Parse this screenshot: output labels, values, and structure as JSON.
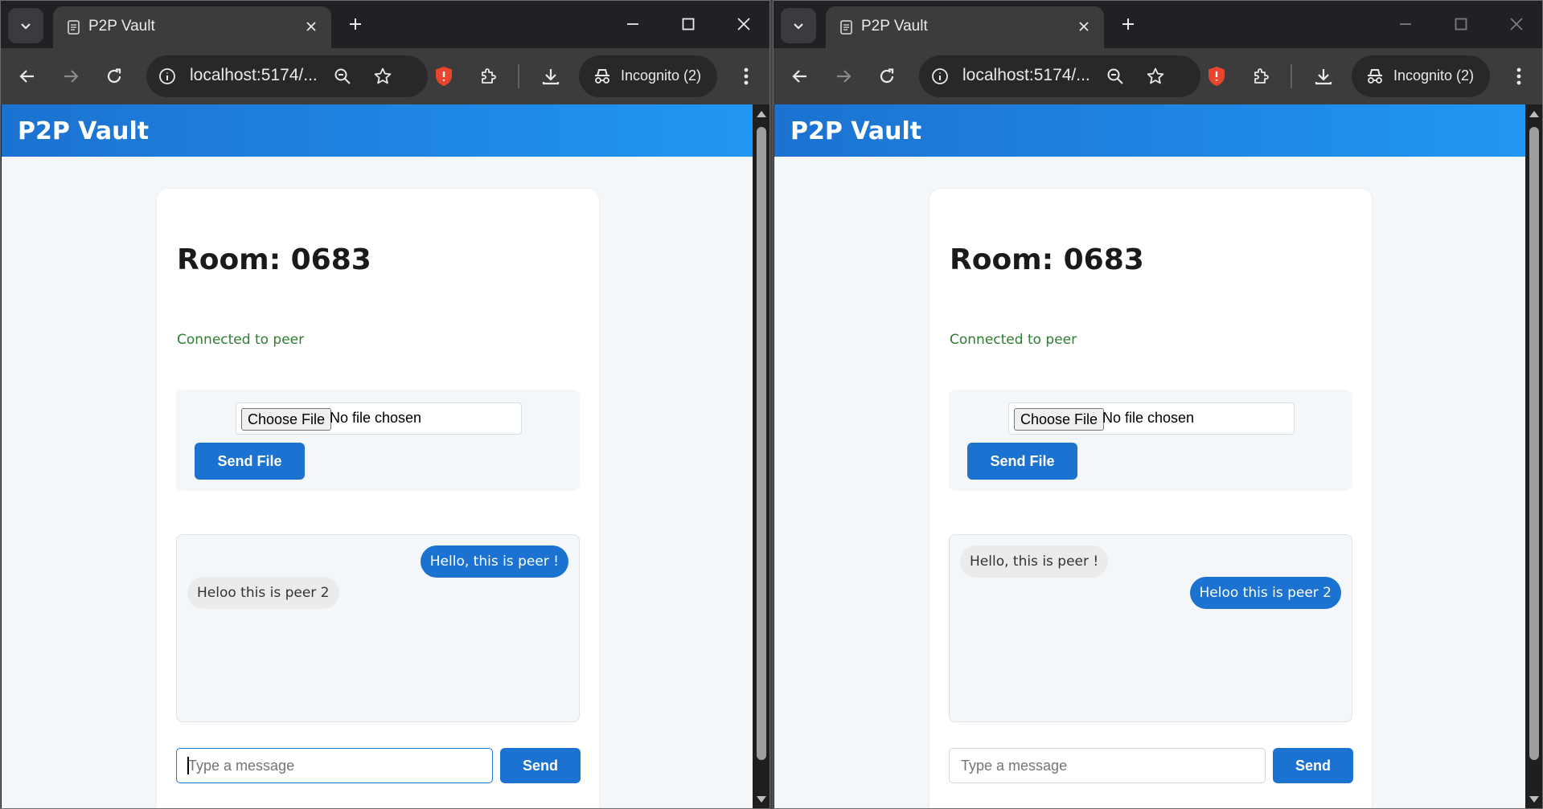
{
  "browser": {
    "tab_title": "P2P Vault",
    "url": "localhost:5174/...",
    "incognito_label": "Incognito (2)"
  },
  "app": {
    "brand": "P2P Vault",
    "room_label": "Room: 0683",
    "status": "Connected to peer",
    "choose_file_label": "Choose File",
    "no_file_label": "No file chosen",
    "send_file_label": "Send File",
    "message_placeholder": "Type a message",
    "send_label": "Send"
  },
  "windows": [
    {
      "messages": [
        {
          "text": "Hello, this is peer !",
          "direction": "outgoing"
        },
        {
          "text": "Heloo this is peer 2",
          "direction": "incoming"
        }
      ],
      "input_focused": true
    },
    {
      "messages": [
        {
          "text": "Hello, this is peer !",
          "direction": "incoming"
        },
        {
          "text": "Heloo this is peer 2",
          "direction": "outgoing"
        }
      ],
      "input_focused": false
    }
  ],
  "colors": {
    "accent": "#1c72d0",
    "appbar_end": "#2196f3",
    "status_green": "#2e7d32",
    "brave_shield": "#e8452c"
  }
}
